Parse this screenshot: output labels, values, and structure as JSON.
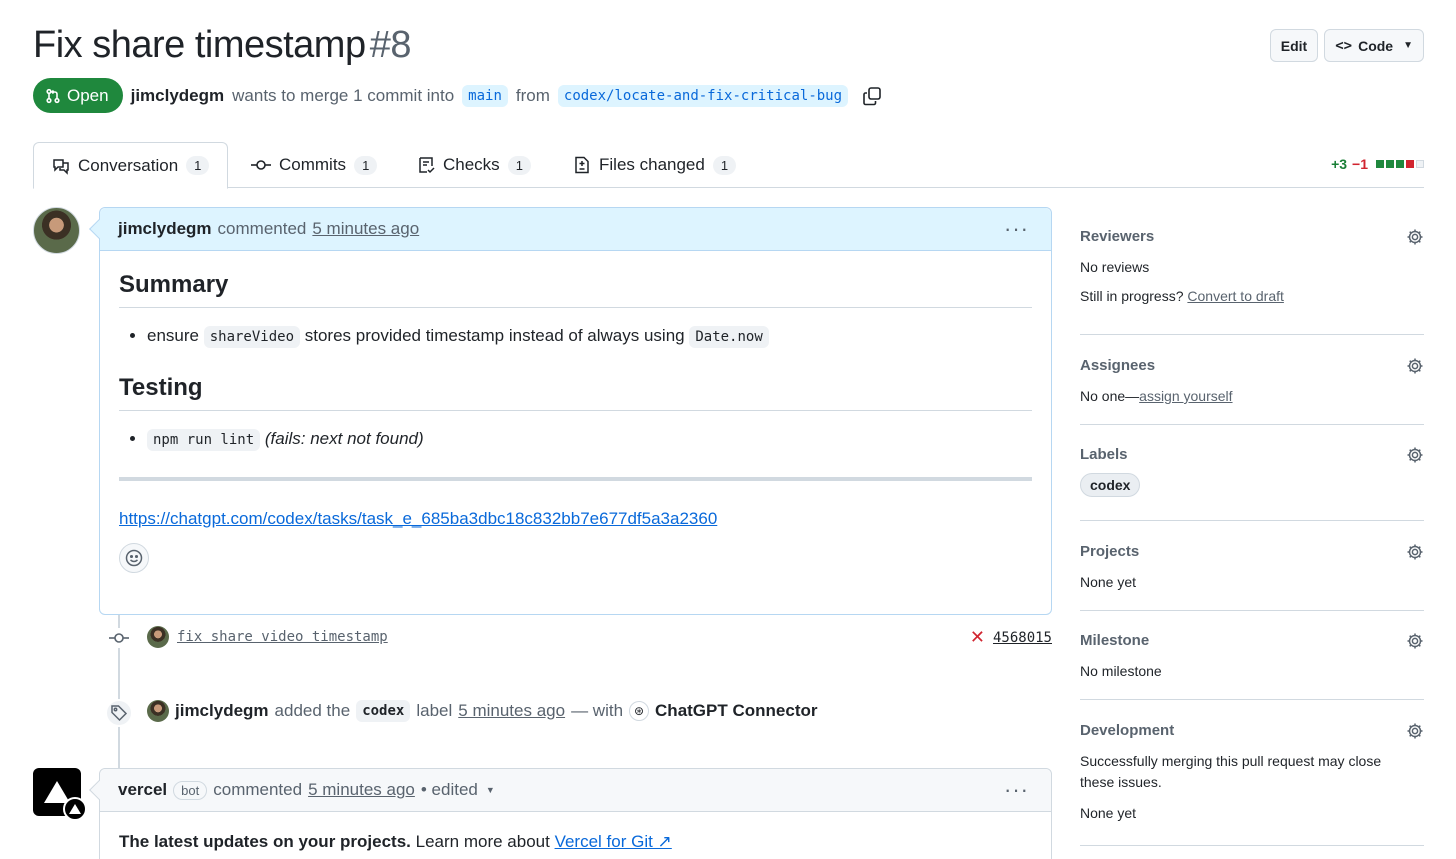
{
  "header": {
    "title": "Fix share timestamp",
    "number": "#8",
    "edit_label": "Edit",
    "code_label": "Code",
    "state": "Open",
    "author": "jimclydegm",
    "merge_text": "wants to merge 1 commit into",
    "base_branch": "main",
    "from_text": "from",
    "head_branch": "codex/locate-and-fix-critical-bug"
  },
  "tabs": [
    {
      "label": "Conversation",
      "count": "1",
      "icon": "comment-discussion-icon"
    },
    {
      "label": "Commits",
      "count": "1",
      "icon": "commit-icon"
    },
    {
      "label": "Checks",
      "count": "1",
      "icon": "checklist-icon"
    },
    {
      "label": "Files changed",
      "count": "1",
      "icon": "file-diff-icon"
    }
  ],
  "diffstat": {
    "additions": "+3",
    "deletions": "−1",
    "blocks": [
      "#1f883d",
      "#1f883d",
      "#1f883d",
      "#d1242f",
      "#d1d9e0"
    ]
  },
  "comment1": {
    "author": "jimclydegm",
    "action": "commented",
    "time": "5 minutes ago",
    "summary_heading": "Summary",
    "summary_item_pre": "ensure",
    "summary_code1": "shareVideo",
    "summary_item_mid": "stores provided timestamp instead of always using",
    "summary_code2": "Date.now",
    "testing_heading": "Testing",
    "testing_code": "npm run lint",
    "testing_note": "(fails: next not found)",
    "link": "https://chatgpt.com/codex/tasks/task_e_685ba3dbc18c832bb7e677df5a3a2360"
  },
  "commit": {
    "message": "fix share video timestamp",
    "sha": "4568015",
    "status": "failed"
  },
  "label_event": {
    "actor": "jimclydegm",
    "added_text": "added the",
    "label": "codex",
    "label_word": "label",
    "time": "5 minutes ago",
    "with_text": "— with",
    "connector": "ChatGPT Connector"
  },
  "comment2": {
    "author": "vercel",
    "badge": "bot",
    "action": "commented",
    "time": "5 minutes ago",
    "edited": "• edited",
    "body_strong": "The latest updates on your projects.",
    "body_text": "Learn more about",
    "body_link": "Vercel for Git ↗"
  },
  "sidebar": {
    "reviewers": {
      "title": "Reviewers",
      "value": "No reviews",
      "progress_q": "Still in progress?",
      "draft_link": "Convert to draft"
    },
    "assignees": {
      "title": "Assignees",
      "value": "No one—",
      "assign_link": "assign yourself"
    },
    "labels": {
      "title": "Labels",
      "value": "codex"
    },
    "projects": {
      "title": "Projects",
      "value": "None yet"
    },
    "milestone": {
      "title": "Milestone",
      "value": "No milestone"
    },
    "development": {
      "title": "Development",
      "value": "Successfully merging this pull request may close these issues.",
      "value2": "None yet"
    }
  }
}
